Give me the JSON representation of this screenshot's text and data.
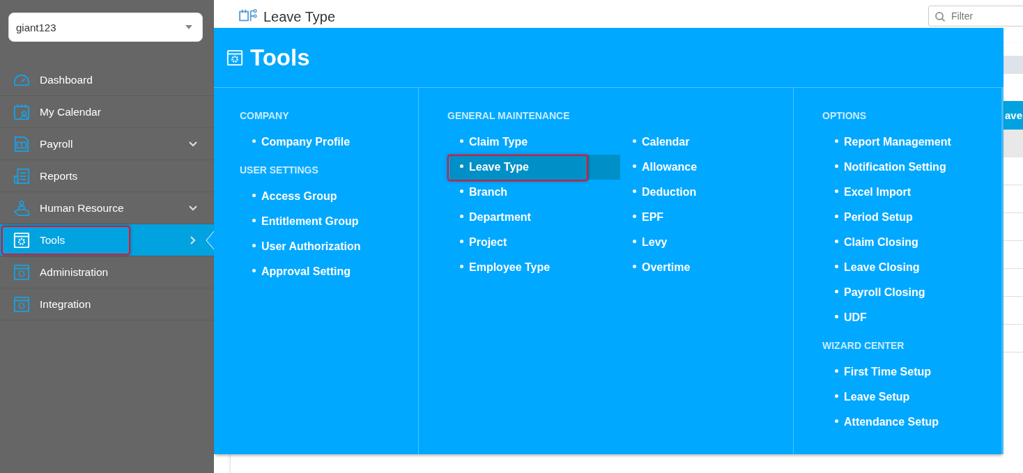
{
  "company_select": {
    "value": "giant123"
  },
  "sidebar": {
    "items": [
      {
        "label": "Dashboard",
        "kind": "link",
        "selected": false,
        "highlighted": false
      },
      {
        "label": "My Calendar",
        "kind": "link",
        "selected": false,
        "highlighted": false
      },
      {
        "label": "Payroll",
        "kind": "group",
        "selected": false,
        "highlighted": false
      },
      {
        "label": "Reports",
        "kind": "link",
        "selected": false,
        "highlighted": false
      },
      {
        "label": "Human Resource",
        "kind": "group",
        "selected": false,
        "highlighted": false
      },
      {
        "label": "Tools",
        "kind": "flyout",
        "selected": true,
        "highlighted": true
      },
      {
        "label": "Administration",
        "kind": "link",
        "selected": false,
        "highlighted": false
      },
      {
        "label": "Integration",
        "kind": "link",
        "selected": false,
        "highlighted": false
      }
    ]
  },
  "page": {
    "title": "Leave Type",
    "filter": {
      "placeholder": "Filter"
    },
    "table": {
      "columns": [
        "ave"
      ]
    }
  },
  "tools_menu": {
    "title": "Tools",
    "columns": [
      {
        "sections": [
          {
            "heading": "COMPANY",
            "items": [
              {
                "label": "Company Profile",
                "selected": false,
                "highlighted": false
              }
            ]
          },
          {
            "heading": "USER SETTINGS",
            "items": [
              {
                "label": "Access Group",
                "selected": false,
                "highlighted": false
              },
              {
                "label": "Entitlement Group",
                "selected": false,
                "highlighted": false
              },
              {
                "label": "User Authorization",
                "selected": false,
                "highlighted": false
              },
              {
                "label": "Approval Setting",
                "selected": false,
                "highlighted": false
              }
            ]
          }
        ]
      },
      {
        "sections": [
          {
            "heading": "GENERAL MAINTENANCE",
            "items": [
              {
                "label": "Claim Type",
                "selected": false,
                "highlighted": false
              },
              {
                "label": "Leave Type",
                "selected": true,
                "highlighted": true
              },
              {
                "label": "Branch",
                "selected": false,
                "highlighted": false
              },
              {
                "label": "Department",
                "selected": false,
                "highlighted": false
              },
              {
                "label": "Project",
                "selected": false,
                "highlighted": false
              },
              {
                "label": "Employee Type",
                "selected": false,
                "highlighted": false
              },
              {
                "label": "Calendar",
                "selected": false,
                "highlighted": false
              },
              {
                "label": "Allowance",
                "selected": false,
                "highlighted": false
              },
              {
                "label": "Deduction",
                "selected": false,
                "highlighted": false
              },
              {
                "label": "EPF",
                "selected": false,
                "highlighted": false
              },
              {
                "label": "Levy",
                "selected": false,
                "highlighted": false
              },
              {
                "label": "Overtime",
                "selected": false,
                "highlighted": false
              }
            ]
          }
        ]
      },
      {
        "sections": [
          {
            "heading": "OPTIONS",
            "items": [
              {
                "label": "Report Management",
                "selected": false,
                "highlighted": false
              },
              {
                "label": "Notification Setting",
                "selected": false,
                "highlighted": false
              },
              {
                "label": "Excel Import",
                "selected": false,
                "highlighted": false
              },
              {
                "label": "Period Setup",
                "selected": false,
                "highlighted": false
              },
              {
                "label": "Claim Closing",
                "selected": false,
                "highlighted": false
              },
              {
                "label": "Leave Closing",
                "selected": false,
                "highlighted": false
              },
              {
                "label": "Payroll Closing",
                "selected": false,
                "highlighted": false
              },
              {
                "label": "UDF",
                "selected": false,
                "highlighted": false
              }
            ]
          },
          {
            "heading": "WIZARD CENTER",
            "items": [
              {
                "label": "First Time Setup",
                "selected": false,
                "highlighted": false
              },
              {
                "label": "Leave Setup",
                "selected": false,
                "highlighted": false
              },
              {
                "label": "Attendance Setup",
                "selected": false,
                "highlighted": false
              }
            ]
          }
        ]
      }
    ]
  }
}
